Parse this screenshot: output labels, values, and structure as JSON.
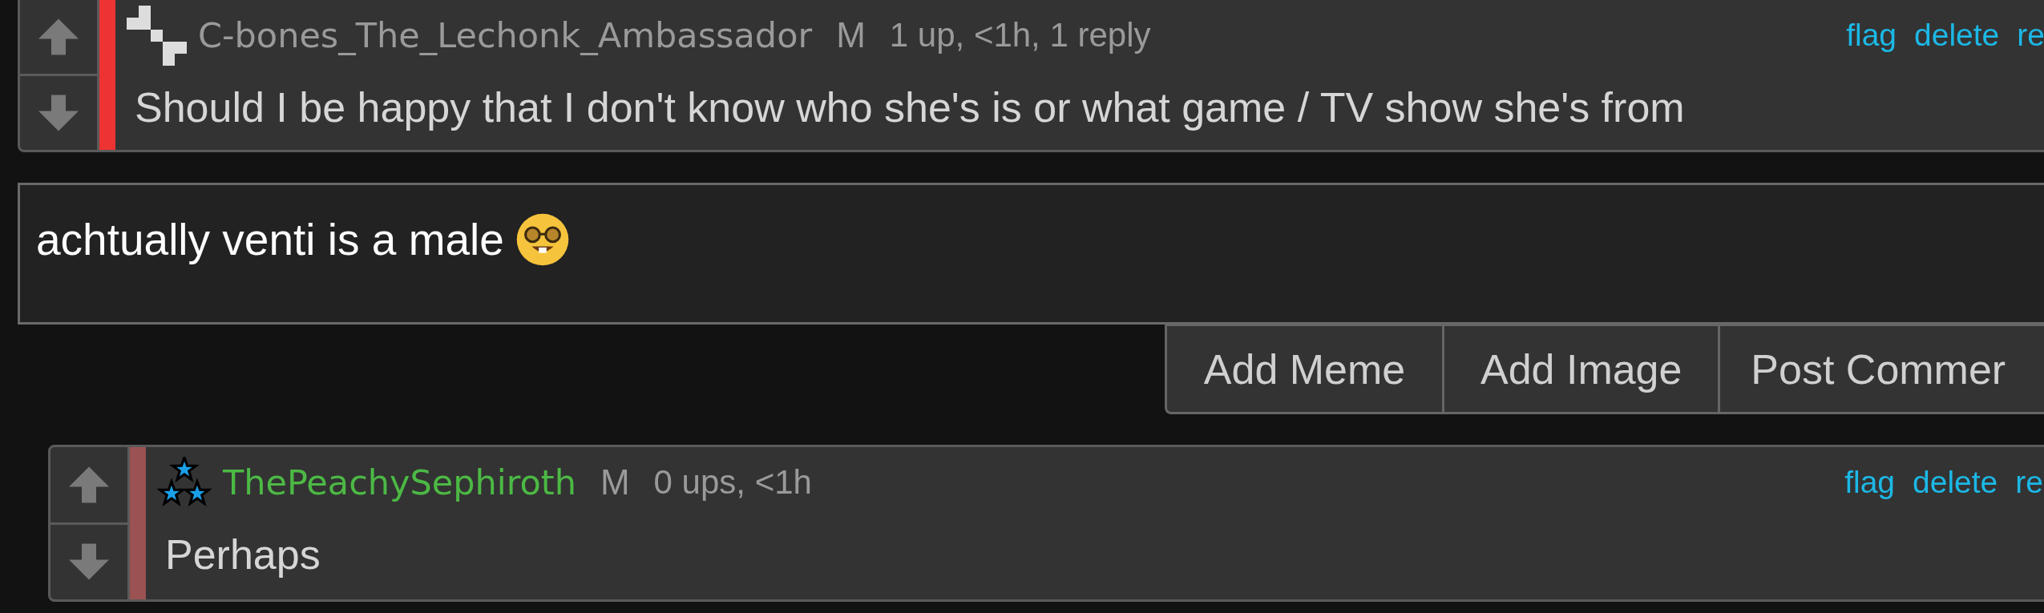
{
  "comments": [
    {
      "avatar": {
        "kind": "pixels"
      },
      "username": {
        "text": "C-bones_The_Lechonk_Ambassador",
        "color": "#9a9a9a"
      },
      "bar": {
        "color": "#ee3333"
      },
      "badge": "M",
      "meta": "1 up, <1h, 1 reply",
      "text": "Should I be happy that I don't know who she's is or what game / TV show she's from",
      "links": [
        "flag",
        "delete",
        "re"
      ],
      "nested": false
    },
    {
      "avatar": {
        "kind": "stars"
      },
      "username": {
        "text": "ThePeachySephiroth",
        "color": "#4cb944"
      },
      "bar": {
        "color": "#9b5252"
      },
      "badge": "M",
      "meta": "0 ups, <1h",
      "text": "Perhaps",
      "links": [
        "flag",
        "delete",
        "re"
      ],
      "nested": true
    }
  ],
  "composer": {
    "value": "achtually venti is a male",
    "emoji": true,
    "buttons": [
      "Add Meme",
      "Add Image",
      "Post Commer"
    ]
  }
}
